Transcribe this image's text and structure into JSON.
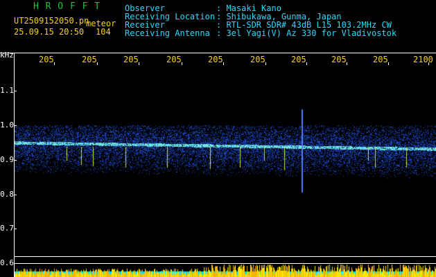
{
  "header": {
    "app_title": "H R O F F T",
    "filename": "UT2509152050.pn",
    "mode_label": "meteor",
    "datetime": "25.09.15 20:50",
    "count": "104"
  },
  "info": {
    "labels": [
      "Observer",
      "Receiving Location",
      "Receiver",
      "Receiving Antenna"
    ],
    "values": [
      ": Masaki Kano",
      ": Shibukawa, Gunma, Japan",
      ": RTL-SDR SDR# 43dB L15 103.2MHz CW",
      ": 3el Yagi(V) Az 330 for Vladivostok"
    ]
  },
  "time_axis": {
    "tick_labels": [
      "205",
      "205",
      "205",
      "205",
      "205",
      "205",
      "205",
      "205",
      "205",
      "2100"
    ]
  },
  "freq_axis": {
    "unit": "kHz",
    "tick_labels": [
      "1.1",
      "1.0",
      "0.9",
      "0.8",
      "0.7",
      "0.6"
    ]
  },
  "colors": {
    "title": "#19c53a",
    "info_text": "#28d9ff",
    "filename_text": "#f7d21b",
    "axis": "#ffffff",
    "echo_trace": "#5df2d0",
    "noise": "#1a2cc8",
    "bar_fill": "#ffe600",
    "bar_base": "#00d9ff"
  }
}
